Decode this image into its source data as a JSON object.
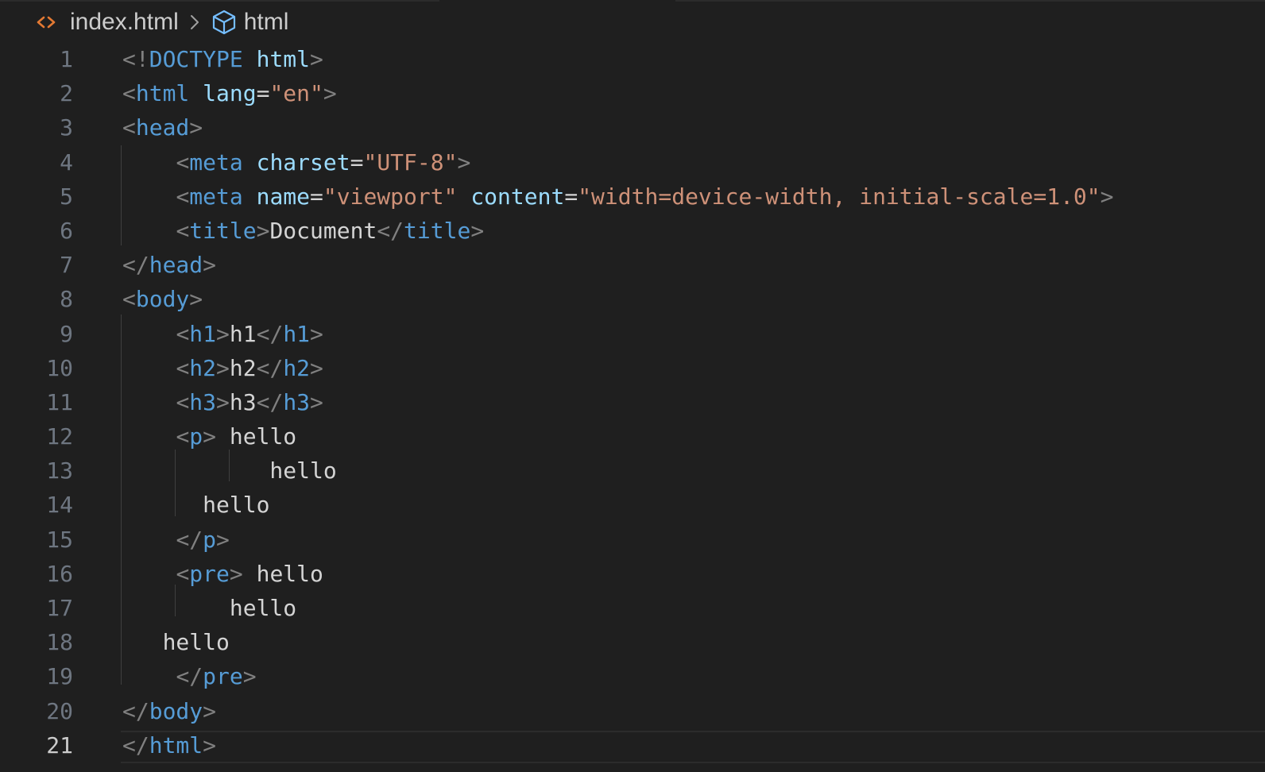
{
  "breadcrumb": {
    "file_icon": "html-file-icon",
    "file": "index.html",
    "separator_icon": "chevron-right-icon",
    "symbol_icon": "cube-symbol-icon",
    "symbol": "html"
  },
  "editor": {
    "active_line": 21,
    "colors": {
      "background": "#1f1f1f",
      "punctuation": "#808080",
      "tag": "#569cd6",
      "attribute": "#9cdcfe",
      "string": "#ce9178",
      "text": "#d4d4d4",
      "line_number": "#6e7681",
      "active_line_number": "#cccccc",
      "file_icon": "#e37933"
    },
    "lines": [
      [
        [
          "p",
          "<!"
        ],
        [
          "t",
          "DOCTYPE"
        ],
        [
          "x",
          " "
        ],
        [
          "a",
          "html"
        ],
        [
          "p",
          ">"
        ]
      ],
      [
        [
          "p",
          "<"
        ],
        [
          "t",
          "html"
        ],
        [
          "x",
          " "
        ],
        [
          "a",
          "lang"
        ],
        [
          "x",
          "="
        ],
        [
          "s",
          "\"en\""
        ],
        [
          "p",
          ">"
        ]
      ],
      [
        [
          "p",
          "<"
        ],
        [
          "t",
          "head"
        ],
        [
          "p",
          ">"
        ]
      ],
      [
        [
          "x",
          "    "
        ],
        [
          "p",
          "<"
        ],
        [
          "t",
          "meta"
        ],
        [
          "x",
          " "
        ],
        [
          "a",
          "charset"
        ],
        [
          "x",
          "="
        ],
        [
          "s",
          "\"UTF-8\""
        ],
        [
          "p",
          ">"
        ]
      ],
      [
        [
          "x",
          "    "
        ],
        [
          "p",
          "<"
        ],
        [
          "t",
          "meta"
        ],
        [
          "x",
          " "
        ],
        [
          "a",
          "name"
        ],
        [
          "x",
          "="
        ],
        [
          "s",
          "\"viewport\""
        ],
        [
          "x",
          " "
        ],
        [
          "a",
          "content"
        ],
        [
          "x",
          "="
        ],
        [
          "s",
          "\"width=device-width, initial-scale=1.0\""
        ],
        [
          "p",
          ">"
        ]
      ],
      [
        [
          "x",
          "    "
        ],
        [
          "p",
          "<"
        ],
        [
          "t",
          "title"
        ],
        [
          "p",
          ">"
        ],
        [
          "x",
          "Document"
        ],
        [
          "p",
          "</"
        ],
        [
          "t",
          "title"
        ],
        [
          "p",
          ">"
        ]
      ],
      [
        [
          "p",
          "</"
        ],
        [
          "t",
          "head"
        ],
        [
          "p",
          ">"
        ]
      ],
      [
        [
          "p",
          "<"
        ],
        [
          "t",
          "body"
        ],
        [
          "p",
          ">"
        ]
      ],
      [
        [
          "x",
          "    "
        ],
        [
          "p",
          "<"
        ],
        [
          "t",
          "h1"
        ],
        [
          "p",
          ">"
        ],
        [
          "x",
          "h1"
        ],
        [
          "p",
          "</"
        ],
        [
          "t",
          "h1"
        ],
        [
          "p",
          ">"
        ]
      ],
      [
        [
          "x",
          "    "
        ],
        [
          "p",
          "<"
        ],
        [
          "t",
          "h2"
        ],
        [
          "p",
          ">"
        ],
        [
          "x",
          "h2"
        ],
        [
          "p",
          "</"
        ],
        [
          "t",
          "h2"
        ],
        [
          "p",
          ">"
        ]
      ],
      [
        [
          "x",
          "    "
        ],
        [
          "p",
          "<"
        ],
        [
          "t",
          "h3"
        ],
        [
          "p",
          ">"
        ],
        [
          "x",
          "h3"
        ],
        [
          "p",
          "</"
        ],
        [
          "t",
          "h3"
        ],
        [
          "p",
          ">"
        ]
      ],
      [
        [
          "x",
          "    "
        ],
        [
          "p",
          "<"
        ],
        [
          "t",
          "p"
        ],
        [
          "p",
          ">"
        ],
        [
          "x",
          " hello"
        ]
      ],
      [
        [
          "x",
          "           hello"
        ]
      ],
      [
        [
          "x",
          "      hello"
        ]
      ],
      [
        [
          "x",
          "    "
        ],
        [
          "p",
          "</"
        ],
        [
          "t",
          "p"
        ],
        [
          "p",
          ">"
        ]
      ],
      [
        [
          "x",
          "    "
        ],
        [
          "p",
          "<"
        ],
        [
          "t",
          "pre"
        ],
        [
          "p",
          ">"
        ],
        [
          "x",
          " hello"
        ]
      ],
      [
        [
          "x",
          "        hello"
        ]
      ],
      [
        [
          "x",
          "   hello"
        ]
      ],
      [
        [
          "x",
          "    "
        ],
        [
          "p",
          "</"
        ],
        [
          "t",
          "pre"
        ],
        [
          "p",
          ">"
        ]
      ],
      [
        [
          "p",
          "</"
        ],
        [
          "t",
          "body"
        ],
        [
          "p",
          ">"
        ]
      ],
      [
        [
          "p",
          "</"
        ],
        [
          "t",
          "html"
        ],
        [
          "p",
          ">"
        ]
      ]
    ]
  }
}
